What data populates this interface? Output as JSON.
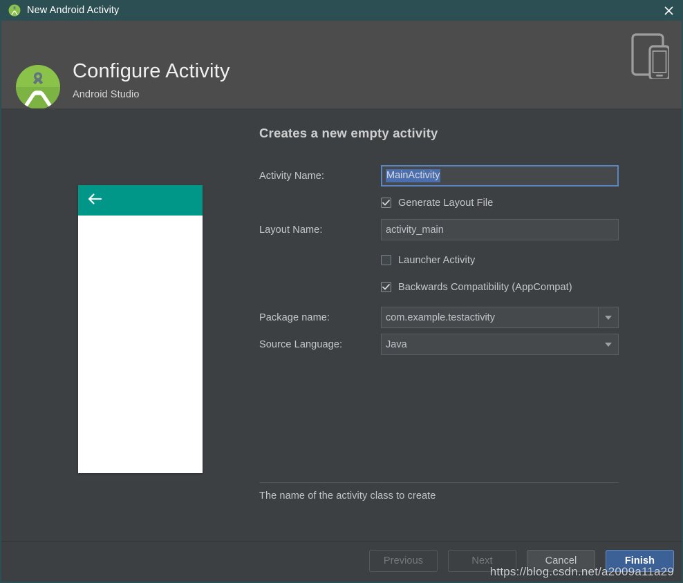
{
  "window": {
    "title": "New Android Activity",
    "title_icon": "android-studio-icon",
    "close_icon": "close-icon",
    "titlebar_color": "#2c4f54"
  },
  "header": {
    "title": "Configure Activity",
    "subtitle": "Android Studio",
    "logo_icon": "android-studio-logo",
    "device_icon": "tablet-and-phone-icon",
    "background_color": "#4c4c4c"
  },
  "main": {
    "form_title": "Creates a new empty activity",
    "preview": {
      "appbar_color": "#009688",
      "back_icon": "back-arrow-icon",
      "body_color": "#ffffff"
    },
    "fields": {
      "activity_name": {
        "label": "Activity Name:",
        "value": "MainActivity",
        "selected": true,
        "focused": true,
        "selection_color": "#4b6eaf"
      },
      "generate_layout_file": {
        "label": "Generate Layout File",
        "checked": true
      },
      "layout_name": {
        "label": "Layout Name:",
        "value": "activity_main"
      },
      "launcher_activity": {
        "label": "Launcher Activity",
        "checked": false
      },
      "backwards_compatibility": {
        "label": "Backwards Compatibility (AppCompat)",
        "checked": true
      },
      "package_name": {
        "label": "Package name:",
        "value": "com.example.testactivity",
        "type": "editable-combo"
      },
      "source_language": {
        "label": "Source Language:",
        "value": "Java",
        "type": "dropdown"
      }
    },
    "help_text": "The name of the activity class to create"
  },
  "footer": {
    "previous": {
      "label": "Previous",
      "enabled": false
    },
    "next": {
      "label": "Next",
      "enabled": false
    },
    "cancel": {
      "label": "Cancel",
      "enabled": true
    },
    "finish": {
      "label": "Finish",
      "enabled": true,
      "color": "#3c6196"
    }
  },
  "watermark": "https://blog.csdn.net/a2009a11a29"
}
